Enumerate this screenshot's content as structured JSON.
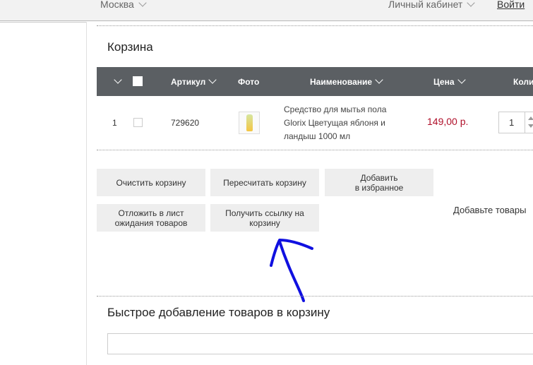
{
  "topbar": {
    "city": "Москва",
    "account": "Личный кабинет",
    "login": "Войти"
  },
  "cart": {
    "title": "Корзина",
    "headers": {
      "article": "Артикул",
      "photo": "Фото",
      "name": "Наименование",
      "price": "Цена",
      "quantity": "Количест"
    },
    "item": {
      "index": "1",
      "article": "729620",
      "name": "Средство для мытья пола Glorix Цветущая яблоня и ландыш 1000 мл",
      "price": "149,00 р.",
      "quantity": "1"
    }
  },
  "buttons": {
    "clear": "Очистить корзину",
    "recalc": "Пересчитать корзину",
    "favorite": "Добавить\nв избранное",
    "waitlist": "Отложить в лист\nожидания товаров",
    "link": "Получить ссылку на\nкорзину"
  },
  "note": "Добавьте товары",
  "quick_add": {
    "title": "Быстрое добавление товаров в корзину",
    "placeholder": ""
  },
  "colors": {
    "header_bg": "#5b5f63",
    "price": "#b0102a",
    "button_bg": "#eeeeee",
    "annotation": "#1010e0"
  }
}
